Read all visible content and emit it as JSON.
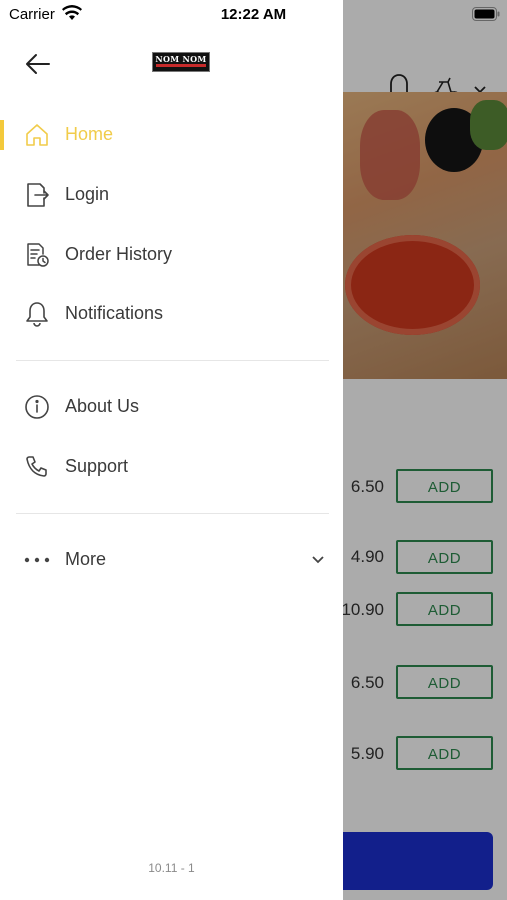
{
  "status_bar": {
    "carrier": "Carrier",
    "time": "12:22 AM"
  },
  "drawer": {
    "logo_text": "NOM NOM",
    "menu": [
      {
        "label": "Home",
        "active": true
      },
      {
        "label": "Login"
      },
      {
        "label": "Order History"
      },
      {
        "label": "Notifications"
      },
      {
        "label": "About Us"
      },
      {
        "label": "Support"
      },
      {
        "label": "More"
      }
    ],
    "version": "10.11 - 1"
  },
  "background": {
    "items": [
      {
        "price": "6.50",
        "button": "ADD"
      },
      {
        "price": "4.90",
        "button": "ADD"
      },
      {
        "price": "10.90",
        "button": "ADD"
      },
      {
        "price": "6.50",
        "button": "ADD"
      },
      {
        "price": "5.90",
        "button": "ADD"
      }
    ]
  },
  "colors": {
    "accent": "#f1cc4a",
    "add_button": "#2e8a4f",
    "cart_bar": "#1b2fd0"
  }
}
